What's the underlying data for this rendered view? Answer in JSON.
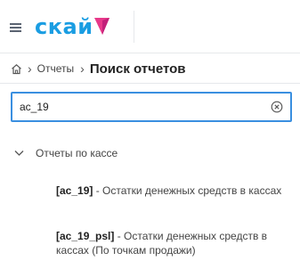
{
  "header": {
    "menu_icon": "hamburger-icon",
    "logo_text": "скай"
  },
  "breadcrumb": {
    "home_icon": "home-icon",
    "separator_1": "›",
    "link_1": "Отчеты",
    "separator_2": "›",
    "current": "Поиск отчетов"
  },
  "search": {
    "value": "ac_19",
    "clear_icon": "clear-circle-icon",
    "accent": "#3a8fe0"
  },
  "results": {
    "group_label": "Отчеты по кассе",
    "group_icon": "chevron-down-icon",
    "items": [
      {
        "code": "[ac_19]",
        "description": " - Остатки денежных средств в кассах"
      },
      {
        "code": "[ac_19_psl]",
        "description": " - Остатки денежных средств в кассах (По точкам продажи)"
      }
    ]
  },
  "colors": {
    "brand": "#1a9de2",
    "brand_mark": "#e8398a"
  }
}
